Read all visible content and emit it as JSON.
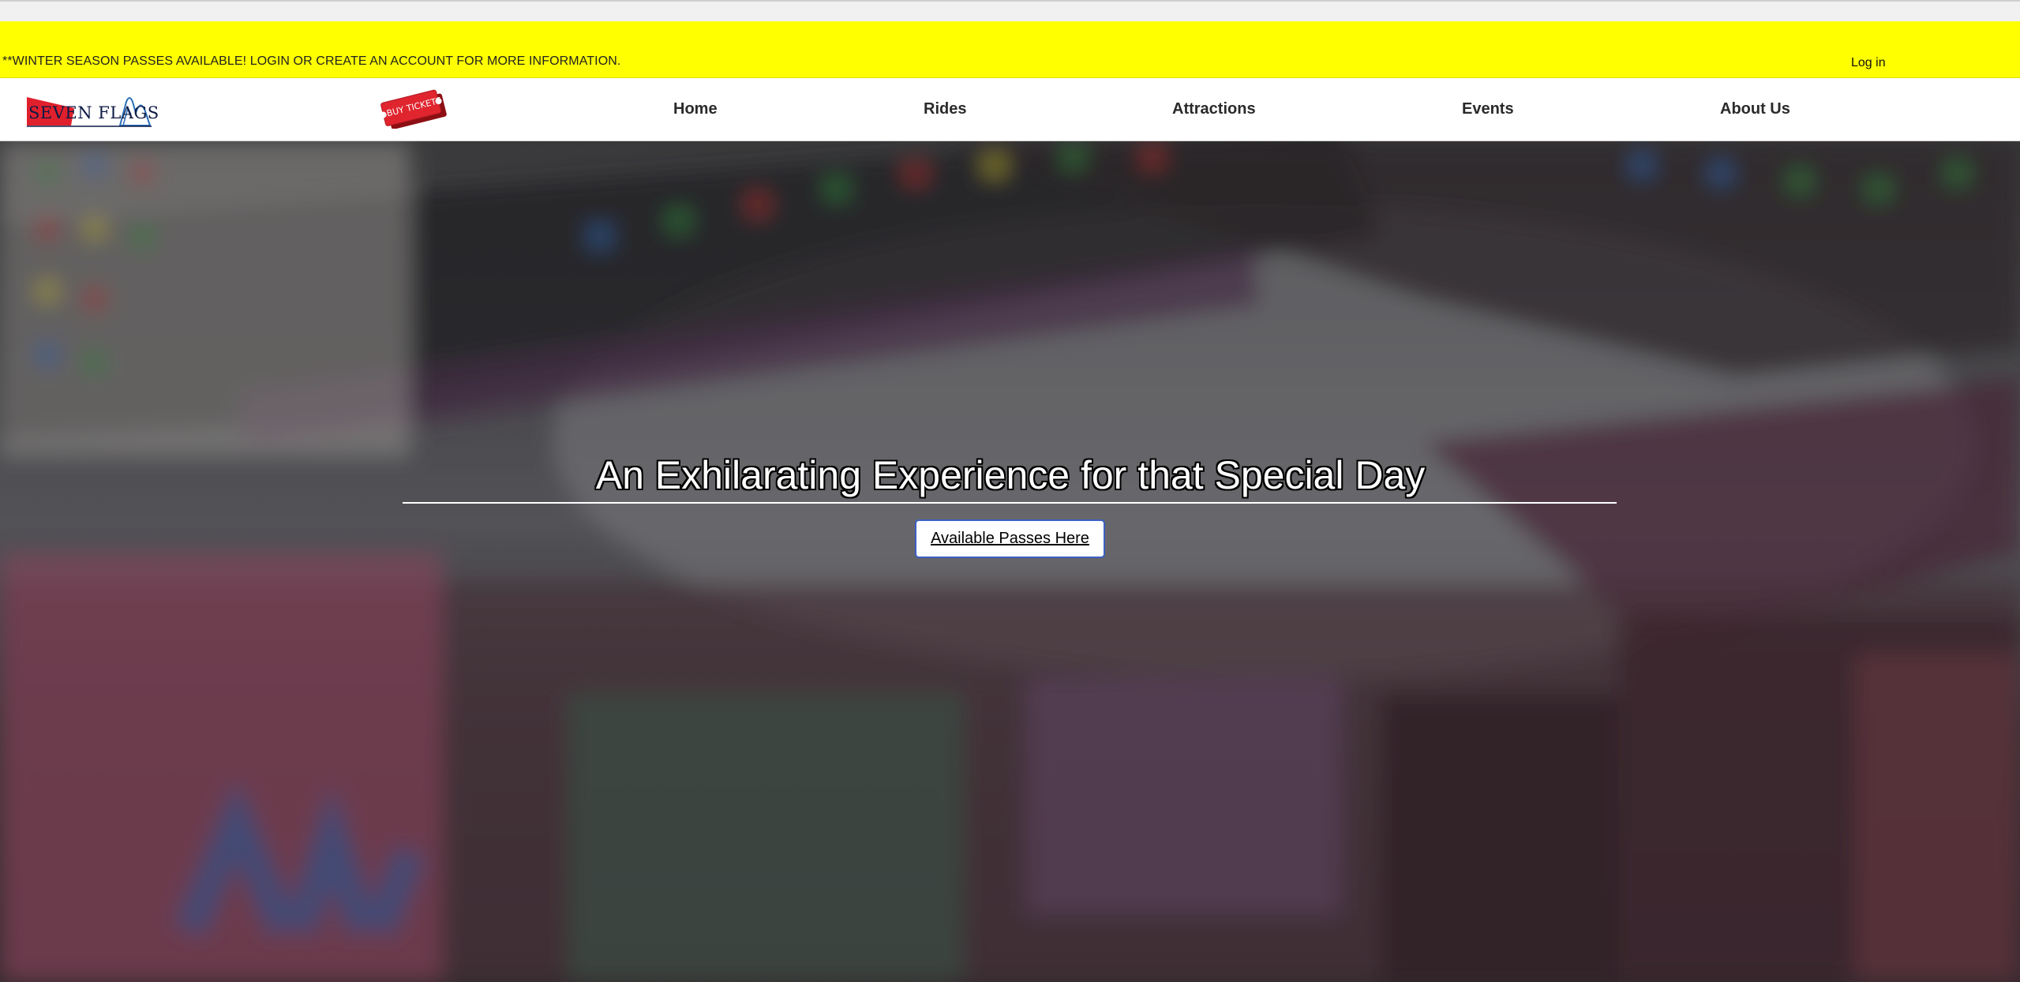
{
  "announcement": {
    "text": "**WINTER SEASON PASSES AVAILABLE! LOGIN OR CREATE AN ACCOUNT FOR MORE INFORMATION.",
    "login_label": "Log in",
    "background_color": "#ffff00"
  },
  "navbar": {
    "logo_text": "SEVEN FLAGS",
    "buy_tickets_label": "BUY TICKETS",
    "items": [
      {
        "label": "Home"
      },
      {
        "label": "Rides"
      },
      {
        "label": "Attractions"
      },
      {
        "label": "Events"
      },
      {
        "label": "About Us"
      }
    ]
  },
  "hero": {
    "title": "An Exhilarating Experience for that Special Day",
    "button_label": "Available Passes Here",
    "button_border_color": "#3b5fc4"
  },
  "icons": {
    "logo": "seven-flags-logo-icon",
    "buy_tickets": "ticket-icon"
  }
}
